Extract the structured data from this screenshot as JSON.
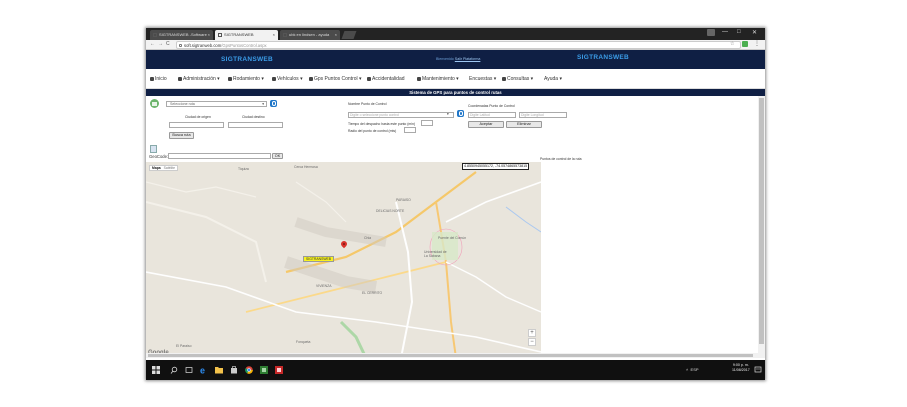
{
  "browser": {
    "tabs": [
      {
        "label": "SIGTRANSWEB -Software"
      },
      {
        "label": "SIGTRANSWEB"
      },
      {
        "label": "ubk en lindsen - ayuda"
      }
    ],
    "url": {
      "host": "soft.sigtranweb.com",
      "path": "/GpsPuntosControl.aspx"
    },
    "window_controls": [
      "—",
      "□",
      "✕"
    ]
  },
  "header": {
    "brand_left": "SIGTRANSWEB",
    "brand_right": "SIGTRANSWEB",
    "welcome_prefix": "Bienvenido",
    "welcome_user": "Salir Plataforma"
  },
  "menu": {
    "items": [
      {
        "label": "Inicio"
      },
      {
        "label": "Administración ▾"
      },
      {
        "label": "Rodamiento ▾"
      },
      {
        "label": "Vehículos ▾"
      },
      {
        "label": "Gps Puntos Control ▾"
      },
      {
        "label": "Accidentalidad"
      },
      {
        "label": "Mantenimiento ▾"
      },
      {
        "label": "Encuestas ▾"
      },
      {
        "label": "Consultas ▾"
      },
      {
        "label": "Ayuda ▾"
      }
    ]
  },
  "page_title": "Sistema de GPS para puntos de control rutas",
  "form": {
    "route_select": "Seleccione ruta",
    "origin_label": "Ciudad de origen",
    "destination_label": "Ciudad destino",
    "search_route_button": "Busca ruta",
    "control_point_label": "Nombre Punto de Control",
    "control_point_placeholder": "Digite o seleccione punto control",
    "dispatch_time_label": "Tiempo del despacho hasta este punto (min)",
    "radius_label": "Radio del punto de control (mts)",
    "coords_label": "Coordenadas Punto de Control",
    "lat_placeholder": "Digite Latitud",
    "lng_placeholder": "Digite Longitud",
    "accept_button": "Aceptar",
    "delete_button": "Eliminar",
    "geocode_label": "GeoCode:",
    "geocode_button": "OK"
  },
  "map": {
    "type_map": "Mapa",
    "type_satellite": "Satélite",
    "coordinate_readout": "4.8550945055172, -74.0574865573815",
    "poi_label": "SIGTRANSWEB",
    "places": [
      {
        "name": "Tiquiza"
      },
      {
        "name": "Cerca Hermosa"
      },
      {
        "name": "PARAISO"
      },
      {
        "name": "DELICIAS NORTE"
      },
      {
        "name": "Chia"
      },
      {
        "name": "Universidad de La Sabana"
      },
      {
        "name": "VIVIENZA"
      },
      {
        "name": "EL CERRITO"
      },
      {
        "name": "Fonqueta"
      },
      {
        "name": "El Paraiso"
      },
      {
        "name": "Puente del Común"
      }
    ],
    "footer": "Datos del mapa ©2017 Google   500 m   Condiciones del servicio   Informar un error en el mapa",
    "google": "Google",
    "zoom_in": "+",
    "zoom_out": "−"
  },
  "points_list_label": "Puntos de control de la ruta",
  "taskbar": {
    "system": "˄   ESP",
    "time": "9:00 p. m.",
    "date": "11/08/2017"
  },
  "colors": {
    "header_bg": "#0f1f44",
    "brand": "#3b9ce8",
    "poi_label": "#f7f21e",
    "pin": "#d9322b"
  }
}
